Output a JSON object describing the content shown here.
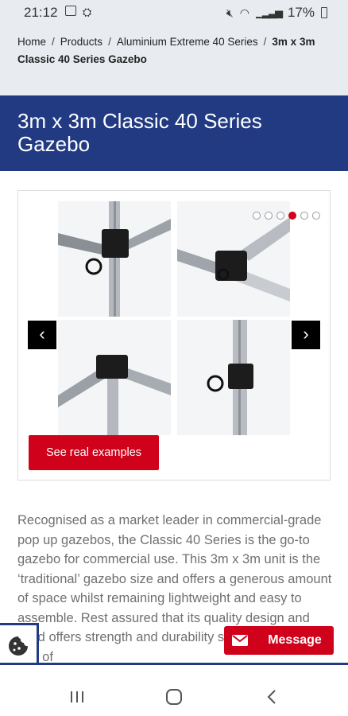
{
  "status_bar": {
    "time": "21:12",
    "battery": "17%"
  },
  "breadcrumb": {
    "items": [
      "Home",
      "Products",
      "Aluminium Extreme 40 Series"
    ],
    "current": "3m x 3m Classic 40 Series Gazebo",
    "separator": "/"
  },
  "page": {
    "title": "3m x 3m Classic 40 Series Gazebo"
  },
  "gallery": {
    "dot_count": 6,
    "active_dot": 3,
    "prev_symbol": "‹",
    "next_symbol": "›",
    "cta_label": "See real examples"
  },
  "description": {
    "text": "Recognised as a market leader in commercial-grade pop up gazebos, the Classic 40 Series is the go-to gazebo for commercial use. This 3m x 3m unit is the ‘traditional’ gazebo size and offers a generous amount of space whilst remaining lightweight and easy to assemble. Rest assured that its quality design and build offers strength and durability so it will stand the test of"
  },
  "message_button": {
    "label": "Message"
  },
  "colors": {
    "brand_blue": "#213a82",
    "accent_red": "#d0021b",
    "breadcrumb_bg": "#e8ecf1",
    "text_grey": "#707070"
  },
  "icons": {
    "status_left": [
      "image-icon",
      "notification-icon"
    ],
    "status_right": [
      "mute-icon",
      "wifi-icon",
      "signal-icon",
      "battery-icon"
    ],
    "cookie": "cookie-icon",
    "message": "envelope-icon",
    "nav": [
      "recents-icon",
      "home-icon",
      "back-icon"
    ]
  }
}
